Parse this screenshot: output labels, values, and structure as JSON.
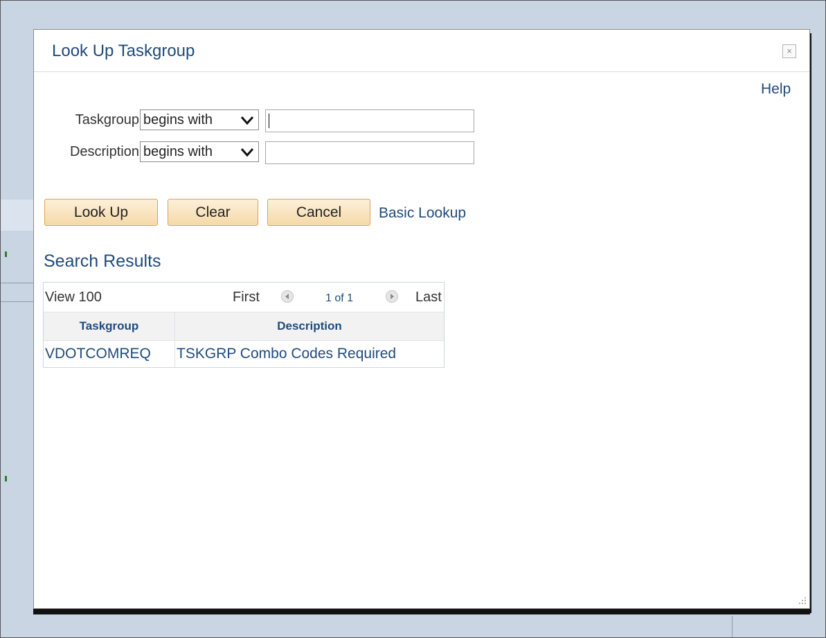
{
  "dialog": {
    "title": "Look Up Taskgroup",
    "close_icon": "×",
    "help_label": "Help"
  },
  "criteria": [
    {
      "label": "Taskgroup",
      "operator": "begins with",
      "value": ""
    },
    {
      "label": "Description",
      "operator": "begins with",
      "value": ""
    }
  ],
  "buttons": {
    "lookup": "Look Up",
    "clear": "Clear",
    "cancel": "Cancel",
    "basic_lookup": "Basic Lookup"
  },
  "results": {
    "title": "Search Results",
    "view_all": "View 100",
    "first": "First",
    "count": "1 of 1",
    "last": "Last",
    "columns": [
      "Taskgroup",
      "Description"
    ],
    "rows": [
      [
        "VDOTCOMREQ",
        "TSKGRP Combo Codes Required"
      ]
    ]
  },
  "colors": {
    "link": "#1f4a7c",
    "button_fill": "#f5d9a8",
    "button_border": "#d6a35a",
    "backdrop": "#c9d5e2"
  },
  "icons": {
    "select_chevron": "chevron-down-icon",
    "prev": "previous-page-icon",
    "next": "next-page-icon",
    "close": "close-icon",
    "resize": "resize-grip-icon"
  }
}
